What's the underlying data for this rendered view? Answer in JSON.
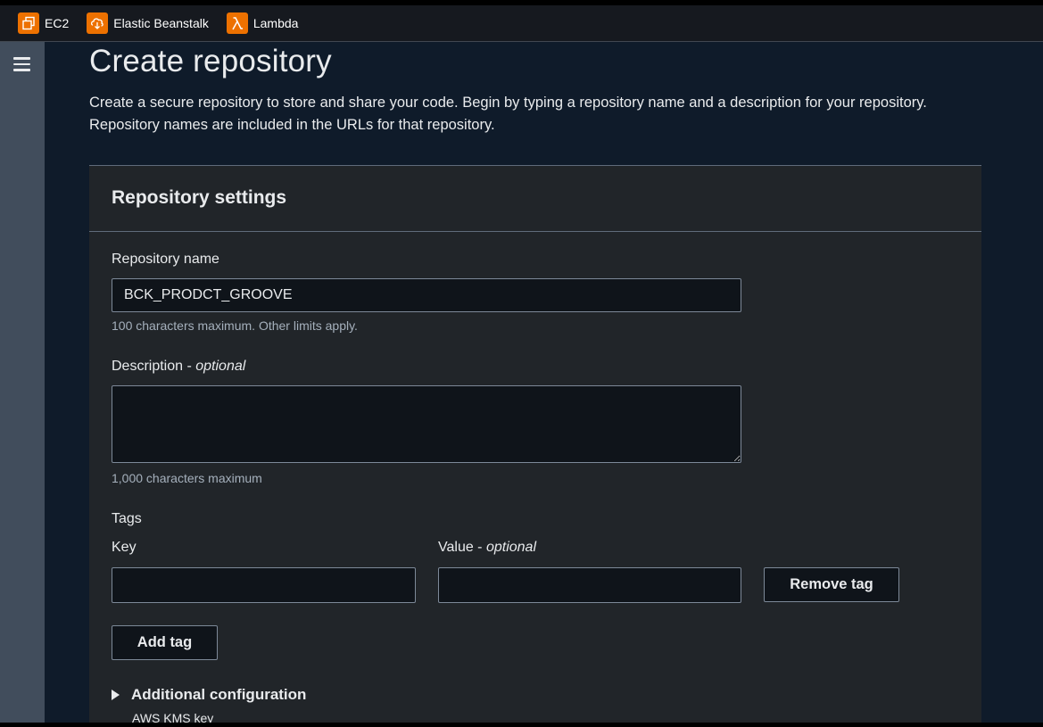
{
  "favorites": [
    {
      "label": "EC2",
      "icon": "ec2-icon"
    },
    {
      "label": "Elastic Beanstalk",
      "icon": "elastic-beanstalk-icon"
    },
    {
      "label": "Lambda",
      "icon": "lambda-icon"
    }
  ],
  "nav": {
    "menu_icon": "hamburger-menu-icon"
  },
  "page": {
    "title": "Create repository",
    "description": "Create a secure repository to store and share your code. Begin by typing a repository name and a description for your repository. Repository names are included in the URLs for that repository."
  },
  "settings": {
    "title": "Repository settings",
    "repo_name_label": "Repository name",
    "repo_name_value": "BCK_PRODCT_GROOVE",
    "repo_name_hint": "100 characters maximum. Other limits apply.",
    "description_label": "Description",
    "optional_suffix": "optional",
    "description_value": "",
    "description_hint": "1,000 characters maximum",
    "tags_label": "Tags",
    "key_label": "Key",
    "value_label": "Value",
    "key_value": "",
    "value_value": "",
    "remove_tag_label": "Remove tag",
    "add_tag_label": "Add tag",
    "additional_config_label": "Additional configuration",
    "kms_label": "AWS KMS key"
  },
  "colors": {
    "accent_orange": "#ed7100",
    "background": "#0f1b2a",
    "container": "#212529"
  }
}
